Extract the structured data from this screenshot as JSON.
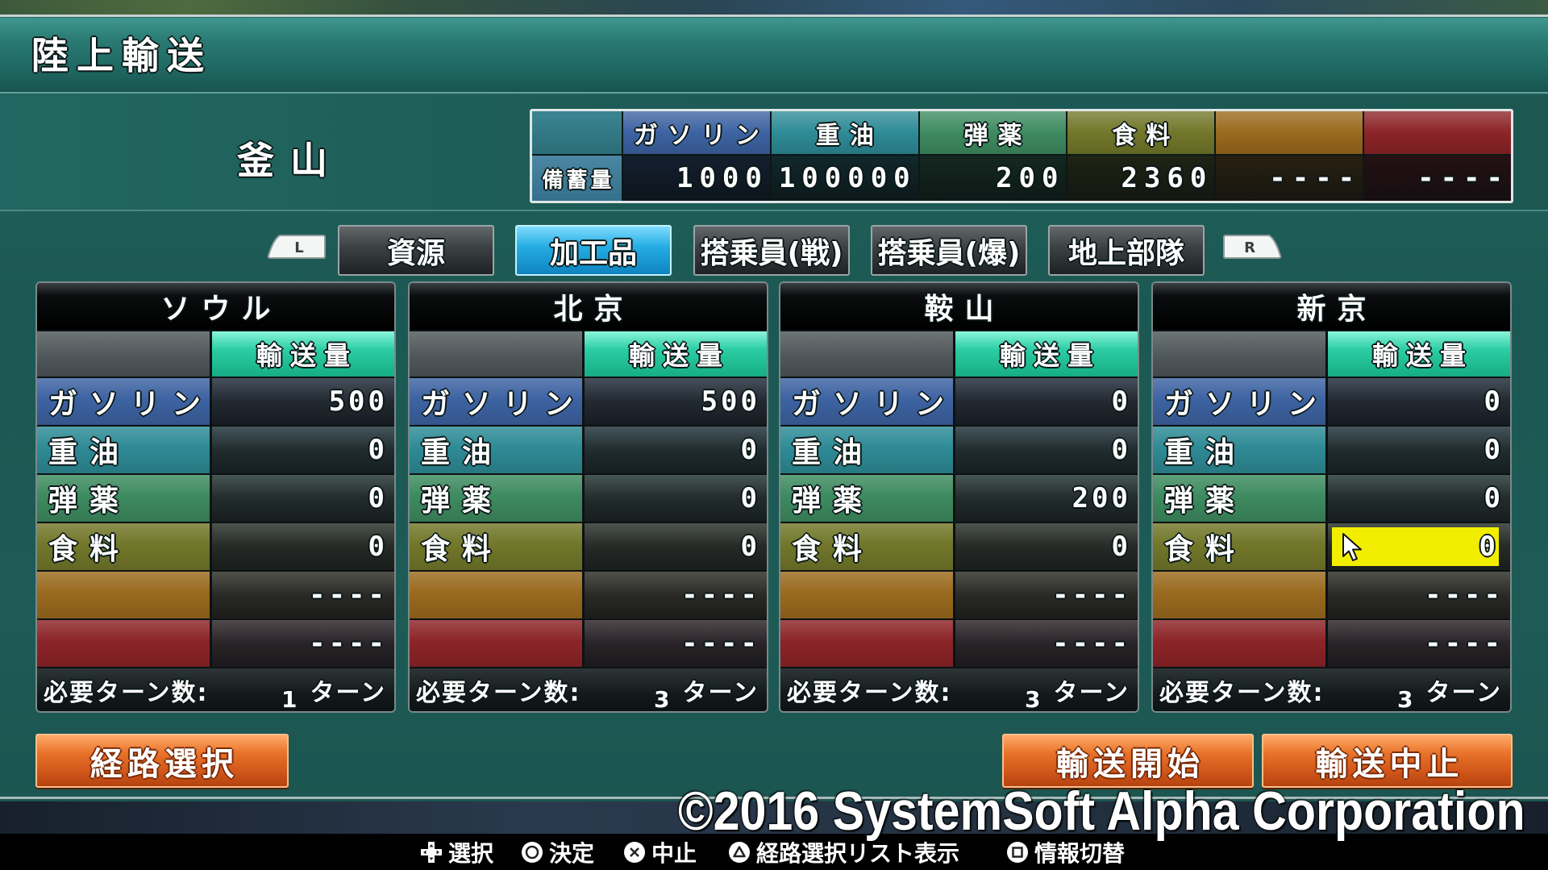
{
  "title": "陸上輸送",
  "origin": {
    "city": "釜山"
  },
  "resources": [
    {
      "label": "ガソリン"
    },
    {
      "label": "重油"
    },
    {
      "label": "弾薬"
    },
    {
      "label": "食料"
    },
    {
      "label": ""
    },
    {
      "label": ""
    }
  ],
  "stock": {
    "row_label": "備蓄量",
    "values": [
      "1000",
      "100000",
      "200",
      "2360",
      "----",
      "----"
    ]
  },
  "tabs": {
    "left_shoulder": "L",
    "right_shoulder": "R",
    "items": [
      {
        "label": "資源",
        "active": false
      },
      {
        "label": "加工品",
        "active": true
      },
      {
        "label": "搭乗員(戦)",
        "active": false
      },
      {
        "label": "搭乗員(爆)",
        "active": false
      },
      {
        "label": "地上部隊",
        "active": false
      }
    ]
  },
  "panel_labels": {
    "transport": "輸送量",
    "turns_label": "必要ターン数:",
    "turns_unit": "ターン"
  },
  "panels": [
    {
      "city": "ソウル",
      "amounts": [
        "500",
        "0",
        "0",
        "0",
        "----",
        "----"
      ],
      "turns": "1"
    },
    {
      "city": "北京",
      "amounts": [
        "500",
        "0",
        "0",
        "0",
        "----",
        "----"
      ],
      "turns": "3"
    },
    {
      "city": "鞍山",
      "amounts": [
        "0",
        "0",
        "200",
        "0",
        "----",
        "----"
      ],
      "turns": "3"
    },
    {
      "city": "新京",
      "amounts": [
        "0",
        "0",
        "0",
        "0",
        "----",
        "----"
      ],
      "turns": "3"
    }
  ],
  "selected": {
    "panel": 3,
    "row": 3
  },
  "buttons": {
    "route_select": "経路選択",
    "start_transport": "輸送開始",
    "stop_transport": "輸送中止"
  },
  "copyright": "©2016 SystemSoft Alpha Corporation",
  "controls": [
    {
      "icon": "dpad-icon",
      "label": "選択"
    },
    {
      "icon": "circle-button-icon",
      "label": "決定"
    },
    {
      "icon": "cross-button-icon",
      "label": "中止"
    },
    {
      "icon": "triangle-button-icon",
      "label": "経路選択リスト表示"
    },
    {
      "icon": "square-button-icon",
      "label": "情報切替"
    }
  ],
  "colors": {
    "gasoline": "#3d63a2",
    "heavy_oil": "#2e8b96",
    "ammo": "#3e8b60",
    "food": "#72772a",
    "slot5": "#9a6a1e",
    "slot6": "#8c2428",
    "transport_header": "#2ccda4",
    "active_tab": "#25ade3",
    "button": "#e8732a",
    "highlight": "#f2ee00"
  }
}
